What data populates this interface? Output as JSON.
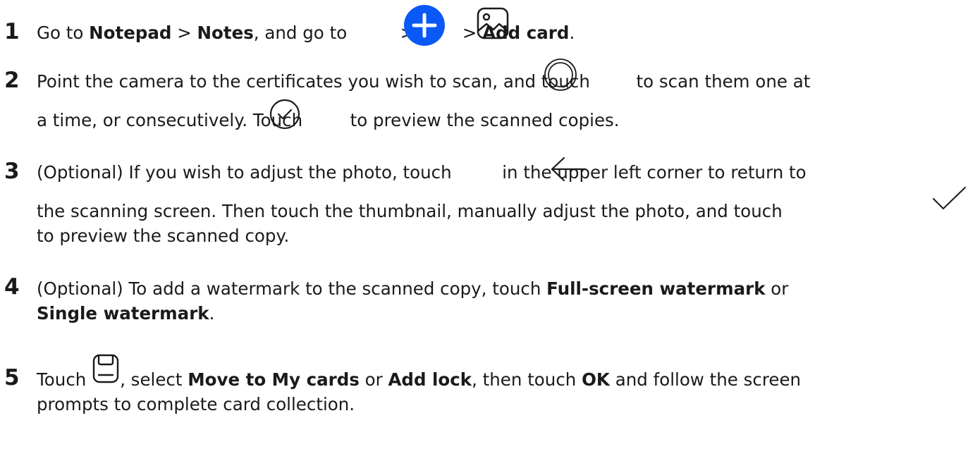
{
  "steps": [
    {
      "number": "1",
      "lines": [
        {
          "parts": [
            {
              "t": "Go to "
            },
            {
              "t": "Notepad",
              "b": true
            },
            {
              "t": " > "
            },
            {
              "t": "Notes",
              "b": true
            },
            {
              "t": ", and go to "
            },
            {
              "icon": "add-circle-icon"
            },
            {
              "t": " > "
            },
            {
              "icon": "image-icon"
            },
            {
              "t": " > "
            },
            {
              "t": "Add card",
              "b": true
            },
            {
              "t": "."
            }
          ]
        }
      ]
    },
    {
      "number": "2",
      "lines": [
        {
          "parts": [
            {
              "t": "Point the camera to the certificates you wish to scan, and touch "
            },
            {
              "icon": "shutter-icon"
            },
            {
              "t": " to scan them one at"
            }
          ]
        },
        {
          "parts": [
            {
              "t": "a time, or consecutively. Touch "
            },
            {
              "icon": "check-circle-icon"
            },
            {
              "t": " to preview the scanned copies."
            }
          ]
        }
      ]
    },
    {
      "number": "3",
      "lines": [
        {
          "parts": [
            {
              "t": "(Optional) If you wish to adjust the photo, touch "
            },
            {
              "icon": "back-arrow-icon"
            },
            {
              "t": " in the upper left corner to return to"
            }
          ]
        },
        {
          "parts": [
            {
              "t": "the scanning screen. Then touch the thumbnail, manually adjust the photo, and touch "
            },
            {
              "icon": "checkmark-icon"
            }
          ]
        },
        {
          "parts": [
            {
              "t": "to preview the scanned copy."
            }
          ]
        }
      ]
    },
    {
      "number": "4",
      "lines": [
        {
          "parts": [
            {
              "t": "(Optional) To add a watermark to the scanned copy, touch "
            },
            {
              "t": "Full-screen watermark",
              "b": true
            },
            {
              "t": " or"
            }
          ]
        },
        {
          "parts": [
            {
              "t": "Single watermark",
              "b": true
            },
            {
              "t": "."
            }
          ]
        }
      ]
    },
    {
      "number": "5",
      "lines": [
        {
          "parts": [
            {
              "t": "Touch "
            },
            {
              "icon": "save-icon"
            },
            {
              "t": ", select "
            },
            {
              "t": "Move to My cards",
              "b": true
            },
            {
              "t": " or "
            },
            {
              "t": "Add lock",
              "b": true
            },
            {
              "t": ", then touch "
            },
            {
              "t": "OK",
              "b": true
            },
            {
              "t": " and follow the screen"
            }
          ]
        },
        {
          "parts": [
            {
              "t": "prompts to complete card collection."
            }
          ]
        }
      ]
    }
  ],
  "colors": {
    "text": "#1a1a1a",
    "accent_blue": "#0a59f7",
    "icon_stroke": "#1a1a1a"
  }
}
